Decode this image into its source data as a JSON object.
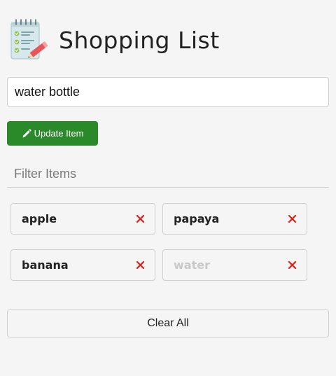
{
  "header": {
    "logo_icon": "notepad-checklist-icon",
    "title": "Shopping List"
  },
  "form": {
    "item_value": "water bottle",
    "update_icon": "pencil-icon",
    "update_label": "Update Item"
  },
  "filter": {
    "placeholder": "Filter Items",
    "value": ""
  },
  "items": [
    {
      "label": "apple",
      "editing": false,
      "delete_icon": "close-x-icon"
    },
    {
      "label": "papaya",
      "editing": false,
      "delete_icon": "close-x-icon"
    },
    {
      "label": "banana",
      "editing": false,
      "delete_icon": "close-x-icon"
    },
    {
      "label": "water",
      "editing": true,
      "delete_icon": "close-x-icon"
    }
  ],
  "clear_all_label": "Clear All",
  "colors": {
    "background": "#f5f5f5",
    "update_button": "#2a8a2a",
    "delete_x": "#e0201a",
    "editing_text": "#c8c8c8",
    "border": "#cfcfcf"
  }
}
